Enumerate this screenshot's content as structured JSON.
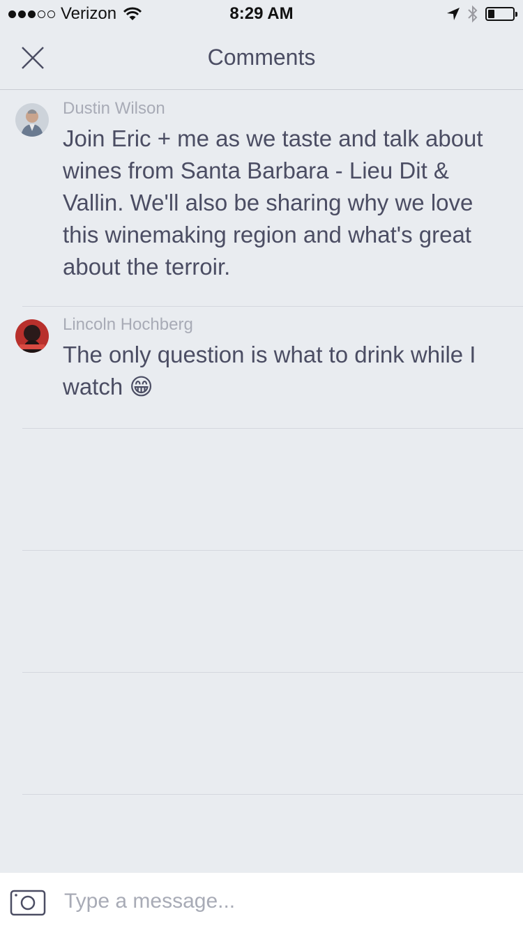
{
  "status_bar": {
    "signal_bars_filled": 3,
    "signal_bars_total": 5,
    "carrier": "Verizon",
    "time": "8:29 AM",
    "battery_level": 0.25,
    "icons": [
      "wifi-icon",
      "location-arrow-icon",
      "bluetooth-icon",
      "battery-icon"
    ]
  },
  "header": {
    "title": "Comments",
    "close_icon": "close-icon"
  },
  "comments": [
    {
      "author": "Dustin Wilson",
      "text": "Join Eric + me as we taste and talk about wines from Santa Barbara - Lieu Dit & Vallin. We'll also be sharing why we love this winemaking region and what's great about the terroir."
    },
    {
      "author": "Lincoln Hochberg",
      "text": "The only question is what to drink while I watch",
      "emoji": "😁"
    }
  ],
  "composer": {
    "placeholder": "Type a message...",
    "camera_icon": "camera-icon"
  }
}
